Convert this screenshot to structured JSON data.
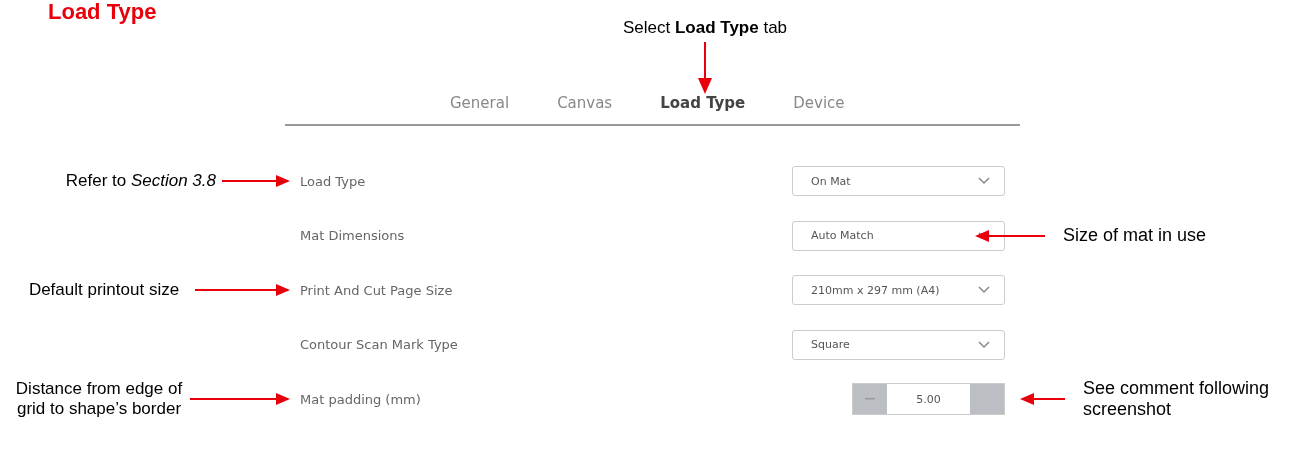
{
  "heading": "Load Type",
  "callout": "Select **Load Type** tab",
  "tabs": [
    {
      "label": "General",
      "selected": false
    },
    {
      "label": "Canvas",
      "selected": false
    },
    {
      "label": "Load Type",
      "selected": true
    },
    {
      "label": "Device",
      "selected": false
    }
  ],
  "settings": [
    {
      "label": "Load Type",
      "kind": "dropdown",
      "value": "On Mat",
      "note_left": "Refer to  *Section 3.8*"
    },
    {
      "label": "Mat Dimensions",
      "kind": "dropdown",
      "value": "Auto Match",
      "note_right": "Size of mat in use"
    },
    {
      "label": "Print And Cut Page Size",
      "kind": "dropdown",
      "value": "210mm x 297 mm (A4)",
      "note_left": "Default printout size"
    },
    {
      "label": "Contour Scan Mark Type",
      "kind": "dropdown",
      "value": "Square"
    },
    {
      "label": "Mat padding (mm)",
      "kind": "stepper",
      "value": "5.00",
      "note_left": "Distance  from edge of grid to shape’s border",
      "note_right": "See comment following screenshot"
    }
  ]
}
